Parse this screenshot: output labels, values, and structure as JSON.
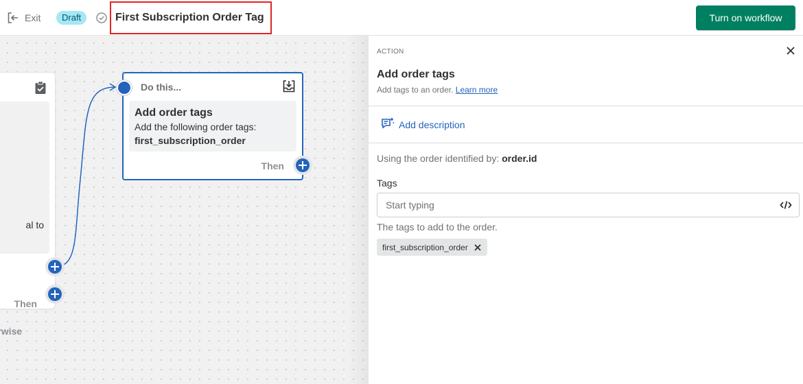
{
  "topbar": {
    "exit_label": "Exit",
    "status_badge": "Draft",
    "workflow_title": "First Subscription Order Tag",
    "turn_on_label": "Turn on workflow"
  },
  "canvas": {
    "condition_card": {
      "partial_text": "al to",
      "then_label": "Then",
      "otherwise_label": "herwise"
    },
    "action_card": {
      "header": "Do this...",
      "title": "Add order tags",
      "description": "Add the following order tags:",
      "tag_value": "first_subscription_order",
      "then_label": "Then"
    }
  },
  "panel": {
    "kicker": "ACTION",
    "title": "Add order tags",
    "subtitle": "Add tags to an order.",
    "learn_more": "Learn more",
    "add_description": "Add description",
    "using_prefix": "Using the order identified by:",
    "using_value": "order.id",
    "tags_label": "Tags",
    "tags_placeholder": "Start typing",
    "tags_help": "The tags to add to the order.",
    "tag_chips": [
      "first_subscription_order"
    ]
  },
  "colors": {
    "primary_button": "#008060",
    "accent_blue": "#2463bc",
    "draft_badge_bg": "#a4e8f2",
    "highlight_border": "#e02424"
  },
  "icons": [
    "exit-icon",
    "status-check-icon",
    "clipboard-check-icon",
    "tray-download-icon",
    "plus-icon",
    "close-icon",
    "description-icon",
    "code-icon"
  ]
}
